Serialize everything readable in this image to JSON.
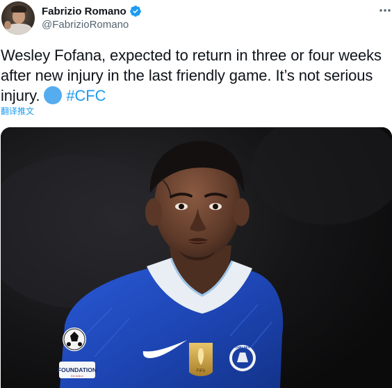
{
  "author": {
    "display_name": "Fabrizio Romano",
    "handle": "@FabrizioRomano",
    "verified": true,
    "verified_color": "#1d9bf0"
  },
  "tweet": {
    "text_main": "Wesley Fofana, expected to return in three or four weeks after new injury in the last friendly game. It’s not serious injury.",
    "emoji": "blue-circle",
    "hashtag": "#CFC",
    "translate_label": "翻译推文"
  },
  "media": {
    "badge_text": "FOUNDATION",
    "crest_text": "CHELSEA",
    "patch_text": "FIFA",
    "kit_color": "#1f4fc4"
  },
  "colors": {
    "text": "#0f1419",
    "secondary": "#536471",
    "link": "#1d9bf0",
    "emoji_blue": "#55acee"
  },
  "icons": {
    "more": "more-horizontal-icon",
    "verified": "verified-badge-icon"
  }
}
